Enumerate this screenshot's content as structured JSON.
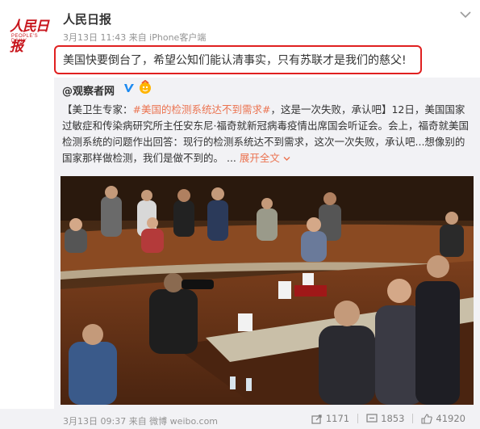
{
  "header": {
    "logo_text": "人民日报",
    "logo_sub": "PEOPLE'S DAILY",
    "author": "人民日报",
    "meta": "3月13日 11:43 来自 iPhone客户端"
  },
  "post": {
    "text": "美国快要倒台了，希望公知们能认清事实，只有苏联才是我们的慈父!"
  },
  "repost": {
    "author": "@观察者网",
    "text_prefix": "【美卫生专家：",
    "hashtag": "#美国的检测系统达不到需求#",
    "text_body": "，这是一次失败，承认吧】12日，美国国家过敏症和传染病研究所主任安东尼·福奇就新冠病毒疫情出席国会听证会。会上，福奇就美国检测系统的问题作出回答：现行的检测系统达不到需求，这次一次失败，承认吧...想像别的国家那样做检测，我们是做不到的。 ...",
    "expand_label": "展开全文",
    "footer_meta": "3月13日 09:37 来自 微博 weibo.com",
    "reposts": "1171",
    "comments": "1853",
    "likes": "41920"
  },
  "colors": {
    "accent": "#eb7350",
    "highlight_border": "#e02020",
    "brand_red": "#c8161d",
    "verified_blue": "#1d8af0"
  }
}
